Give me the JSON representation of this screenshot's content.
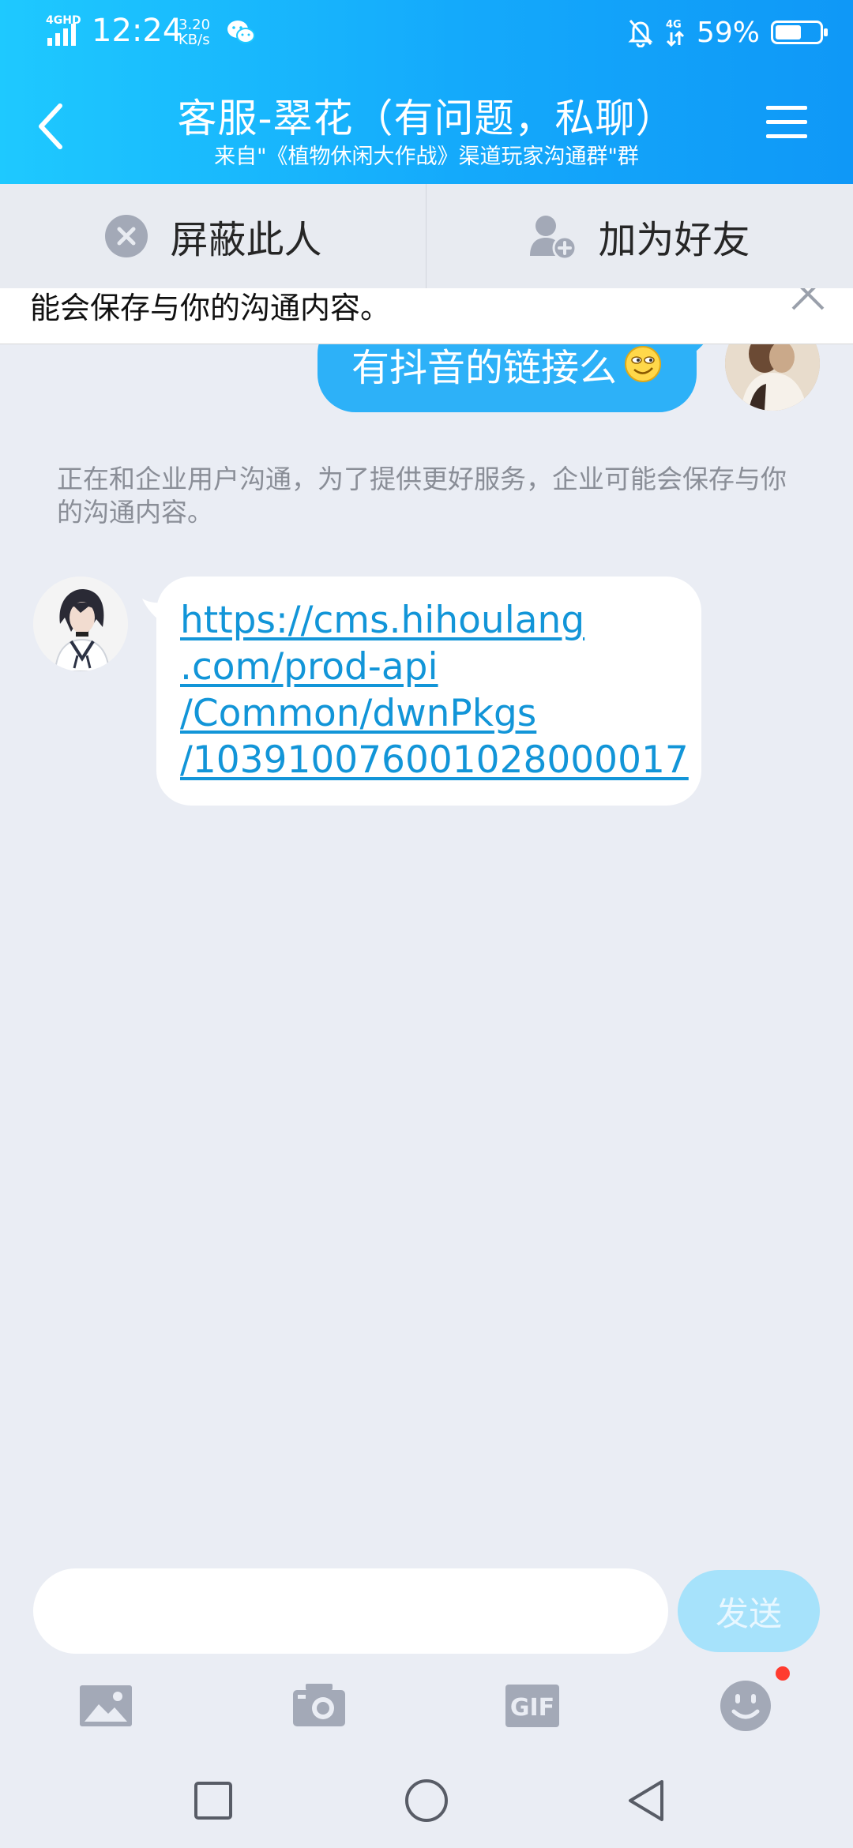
{
  "status_bar": {
    "network_label": "4GHD",
    "time": "12:24",
    "speed_value": "3.20",
    "speed_unit": "KB/s",
    "battery_percent_text": "59%",
    "battery_level": 0.59,
    "mobile_data_label": "4G"
  },
  "header": {
    "title": "客服-翠花（有问题，私聊）",
    "subtitle": "来自\"《植物休闲大作战》渠道玩家沟通群\"群",
    "gradient_start": "#1ec9ff",
    "gradient_end": "#0f98f7"
  },
  "actions": {
    "block_label": "屏蔽此人",
    "add_friend_label": "加为好友"
  },
  "notice_banner": {
    "text": "能会保存与你的沟通内容。"
  },
  "messages": {
    "outgoing_text": "有抖音的链接么",
    "outgoing_color": "#2db1f8",
    "system_notice": "正在和企业用户沟通，为了提供更好服务，企业可能会保存与你的沟通内容。",
    "incoming_link_lines": [
      "https://cms.hihoulang",
      ".com/prod-api",
      "/Common/dwnPkgs",
      "/103910076001028000017"
    ],
    "link_color": "#1295d8"
  },
  "composer": {
    "input_value": "",
    "send_label": "发送",
    "tools": [
      "image-icon",
      "camera-icon",
      "gif-icon",
      "emoji-icon"
    ],
    "gif_label": "GIF"
  }
}
